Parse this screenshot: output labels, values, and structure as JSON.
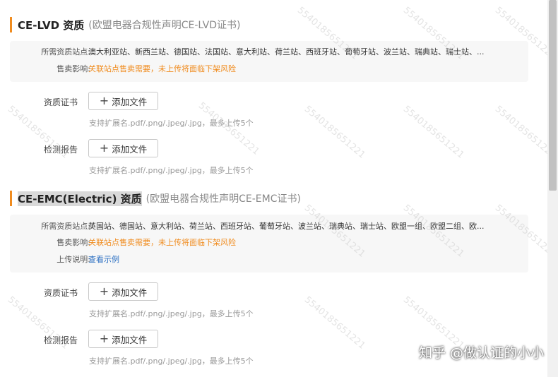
{
  "sections": [
    {
      "title": "CE-LVD 资质",
      "subtitle": "(欧盟电器合规性声明CE-LVD证书)",
      "info": [
        {
          "label": "所需资质站点:",
          "value": "澳大利亚站、新西兰站、德国站、法国站、意大利站、荷兰站、西班牙站、葡萄牙站、波兰站、瑞典站、瑞士站、...",
          "kind": "normal"
        },
        {
          "label": "售卖影响:",
          "value": "关联站点售卖需要，未上传将面临下架风险",
          "kind": "warn"
        }
      ],
      "fields": [
        {
          "label": "资质证书",
          "button": "添加文件",
          "hint": "支持扩展名.pdf/.png/.jpeg/.jpg，最多上传5个"
        },
        {
          "label": "检测报告",
          "button": "添加文件",
          "hint": "支持扩展名.pdf/.png/.jpeg/.jpg，最多上传5个"
        }
      ]
    },
    {
      "title": "CE-EMC(Electric) 资质",
      "subtitle": "(欧盟电器合规性声明CE-EMC证书)",
      "info": [
        {
          "label": "所需资质站点:",
          "value": "英国站、德国站、意大利站、荷兰站、西班牙站、葡萄牙站、波兰站、瑞典站、瑞士站、欧盟一组、欧盟二组、欧...",
          "kind": "normal"
        },
        {
          "label": "售卖影响:",
          "value": "关联站点售卖需要，未上传将面临下架风险",
          "kind": "warn"
        },
        {
          "label": "上传说明:",
          "value": "查看示例",
          "kind": "link"
        }
      ],
      "fields": [
        {
          "label": "资质证书",
          "button": "添加文件",
          "hint": "支持扩展名.pdf/.png/.jpeg/.jpg，最多上传5个"
        },
        {
          "label": "检测报告",
          "button": "添加文件",
          "hint": "支持扩展名.pdf/.png/.jpeg/.jpg，最多上传5个"
        }
      ]
    }
  ],
  "watermark_text": "5540185651221",
  "brand": "知乎 @做认证的小小",
  "colors": {
    "accent": "#f08c1f",
    "link": "#2b6fc2",
    "hint": "#999999"
  }
}
